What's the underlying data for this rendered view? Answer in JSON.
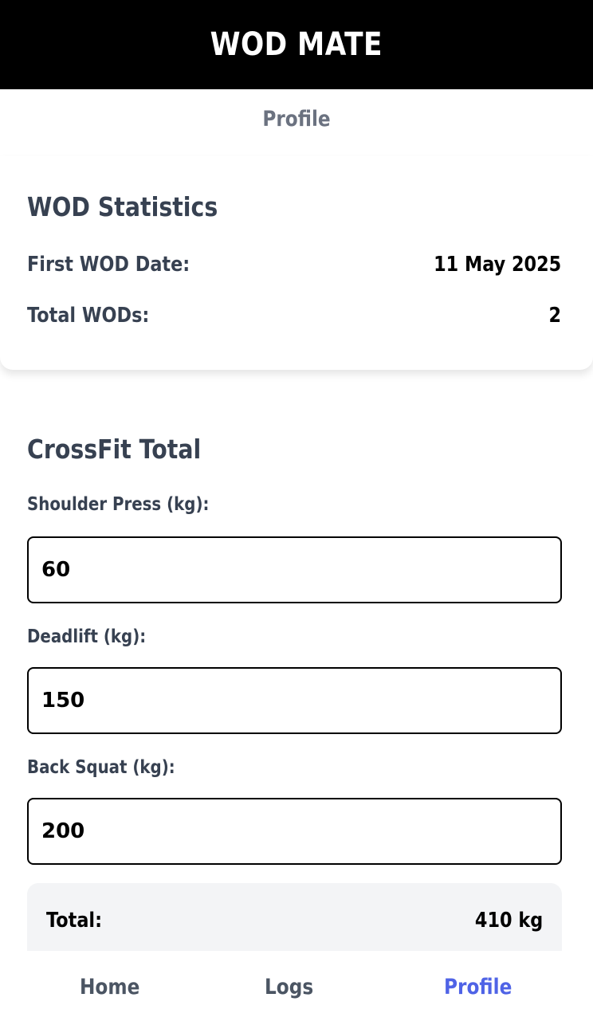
{
  "header": {
    "app_title": "WOD MATE"
  },
  "page": {
    "title": "Profile"
  },
  "stats": {
    "title": "WOD Statistics",
    "first_wod_label": "First WOD Date:",
    "first_wod_value": "11 May 2025",
    "total_wods_label": "Total WODs:",
    "total_wods_value": "2"
  },
  "crossfit_total": {
    "title": "CrossFit Total",
    "shoulder_press_label": "Shoulder Press (kg):",
    "shoulder_press_value": "60",
    "deadlift_label": "Deadlift (kg):",
    "deadlift_value": "150",
    "back_squat_label": "Back Squat (kg):",
    "back_squat_value": "200",
    "total_label": "Total:",
    "total_value": "410 kg"
  },
  "nav": {
    "items": [
      {
        "label": "Home",
        "active": false
      },
      {
        "label": "Logs",
        "active": false
      },
      {
        "label": "Profile",
        "active": true
      }
    ],
    "active_color": "#4f63e6"
  }
}
